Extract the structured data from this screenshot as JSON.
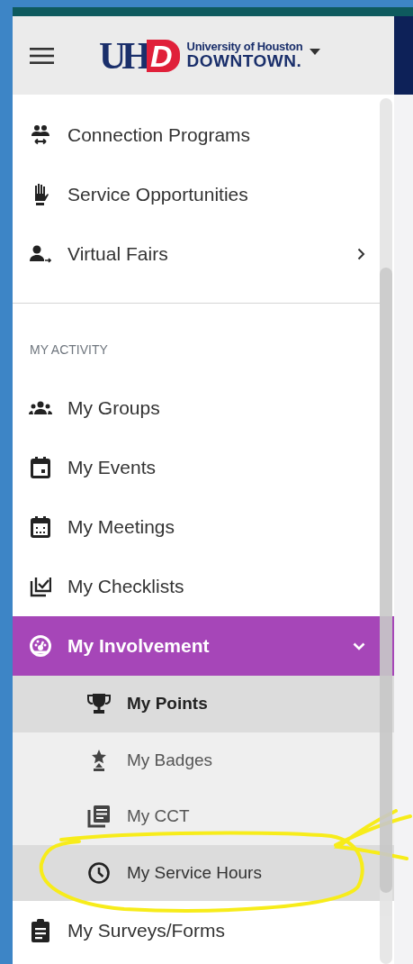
{
  "header": {
    "logo": {
      "mark_left": "UH",
      "mark_right": "D",
      "line1": "University of Houston",
      "line2": "DOWNTOWN."
    }
  },
  "top_items": [
    {
      "label": "Connection Programs",
      "submenu": false
    },
    {
      "label": "Service Opportunities",
      "submenu": false
    },
    {
      "label": "Virtual Fairs",
      "submenu": true
    }
  ],
  "activity": {
    "title": "MY ACTIVITY",
    "items": [
      {
        "kind": "link",
        "label": "My Groups"
      },
      {
        "kind": "link",
        "label": "My Events"
      },
      {
        "kind": "link",
        "label": "My Meetings"
      },
      {
        "kind": "link",
        "label": "My Checklists"
      },
      {
        "kind": "group",
        "label": "My Involvement",
        "active": true,
        "expanded": true,
        "children": [
          {
            "label": "My Points",
            "selected": true,
            "hovered": false
          },
          {
            "label": "My Badges",
            "selected": false,
            "hovered": false
          },
          {
            "label": "My CCT",
            "selected": false,
            "hovered": false
          },
          {
            "label": "My Service Hours",
            "selected": false,
            "hovered": true
          }
        ]
      },
      {
        "kind": "link",
        "label": "My Surveys/Forms"
      }
    ]
  }
}
